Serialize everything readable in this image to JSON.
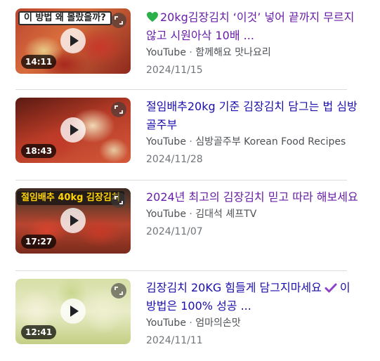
{
  "colors": {
    "title_link": "#1a0dab",
    "title_visited": "#681da8",
    "meta": "#4d5156",
    "date": "#70757a",
    "divider": "#dadce0"
  },
  "videos": [
    {
      "thumb_text": "이 방법 왜 몰랐을까?",
      "duration": "14:11",
      "title_prefix_icon": "green-heart-icon",
      "title_part1": "20kg김장김치 ‘이것’ 넣어 끝까지 무르지 않고 시원아삭 10배 ...",
      "title_part2": "",
      "source": "YouTube",
      "separator": "·",
      "channel": "함께해요 맛나요리",
      "date": "2024/11/15"
    },
    {
      "thumb_text": "",
      "duration": "18:43",
      "title_part1": "절임배추20kg 기준 김장김치 담그는 법 심방골주부",
      "title_part2": "",
      "source": "YouTube",
      "separator": "·",
      "channel": "심방골주부 Korean Food Recipes",
      "date": "2024/11/28"
    },
    {
      "thumb_text": "절임배추 40kg 김장김치",
      "duration": "17:27",
      "title_part1": "2024년 최고의 김장김치 믿고 따라 해보세요",
      "title_part2": "",
      "source": "YouTube",
      "separator": "·",
      "channel": "김대석 셰프TV",
      "date": "2024/11/07"
    },
    {
      "thumb_text": "",
      "duration": "12:41",
      "title_part1": "김장김치 20KG 힘들게 담그지마세요",
      "title_inline_icon": "purple-check-icon",
      "title_part2": "이 방법은 100% 성공 ...",
      "source": "YouTube",
      "separator": "·",
      "channel": "엄마의손맛",
      "date": "2024/11/11"
    }
  ]
}
